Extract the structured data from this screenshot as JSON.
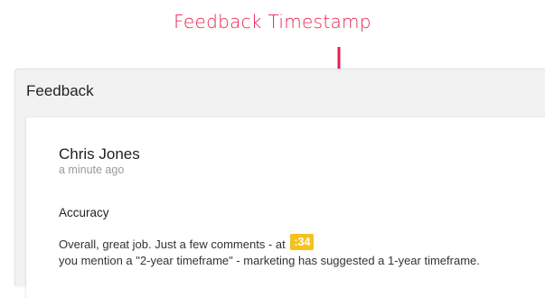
{
  "annotation": {
    "label": "Feedback Timestamp",
    "color": "#e8204f"
  },
  "panel": {
    "title": "Feedback"
  },
  "comment": {
    "author": "Chris Jones",
    "time": "a minute ago",
    "section": "Accuracy",
    "line1_text": "Overall, great job. Just a few comments - at",
    "timestamp": ":34",
    "timestamp_color": "#f4c21c",
    "line2_text": "you mention a \"2-year timeframe\" - marketing has suggested a 1-year timeframe."
  }
}
